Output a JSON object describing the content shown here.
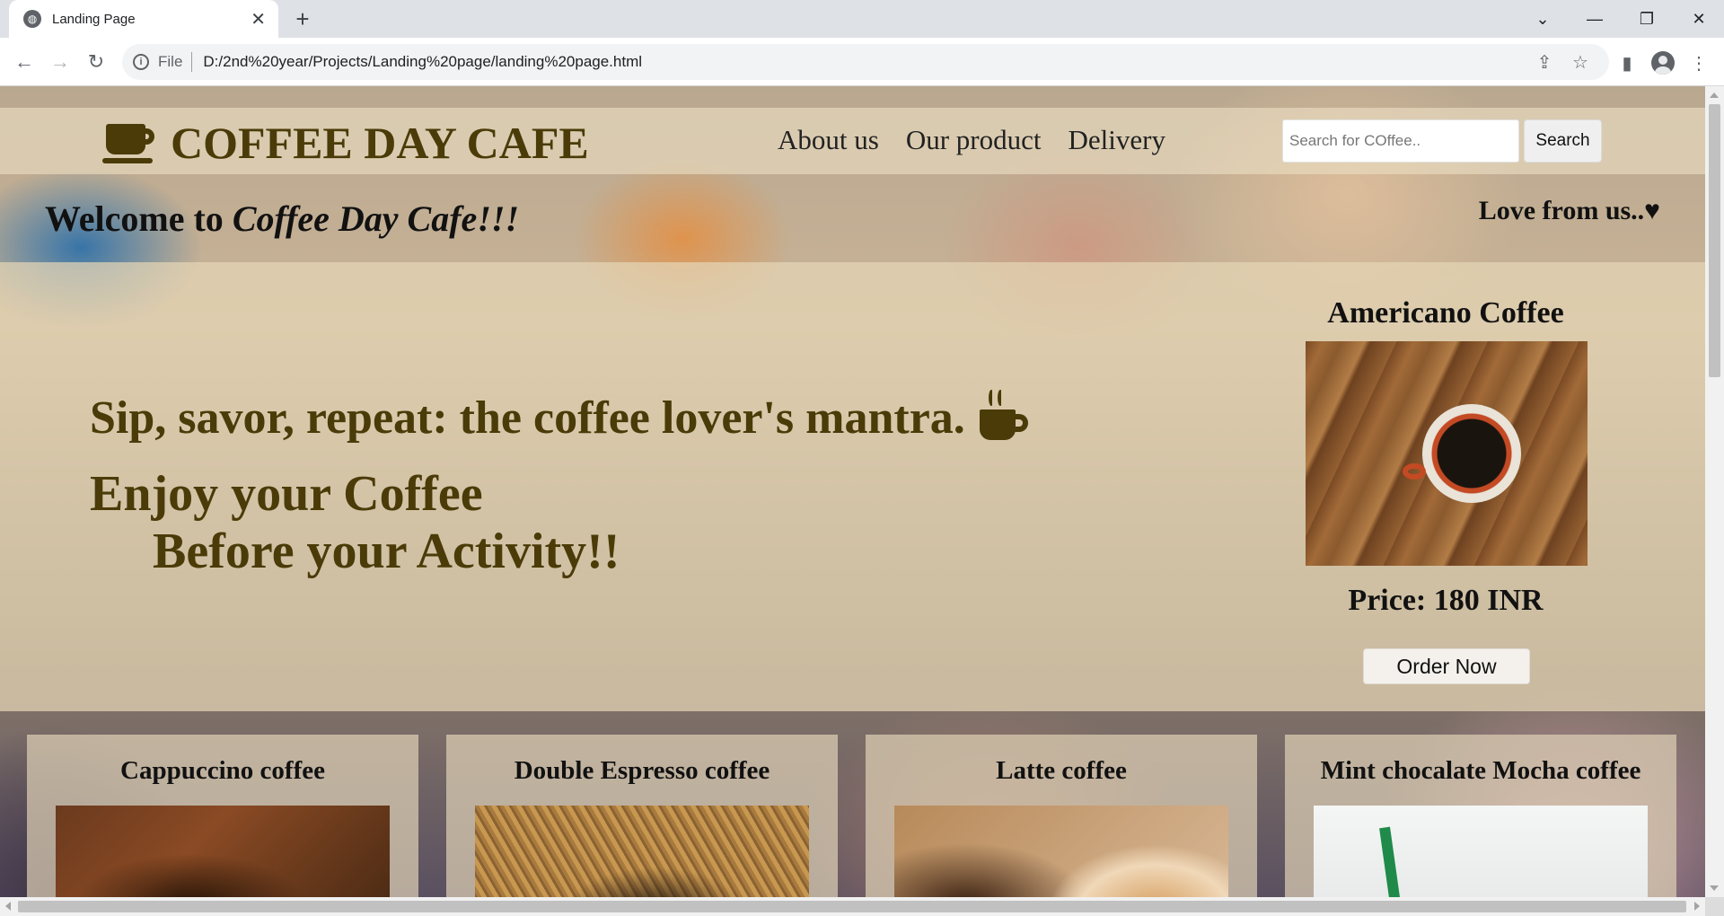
{
  "browser": {
    "tab_title": "Landing Page",
    "new_tab": "+",
    "tab_close": "✕",
    "controls": {
      "tabsearch": "⌄",
      "minimize": "—",
      "restore": "❐",
      "close": "✕"
    },
    "nav": {
      "back": "←",
      "forward": "→",
      "reload": "↻"
    },
    "info_icon": "i",
    "url_scheme": "File",
    "url": "D:/2nd%20year/Projects/Landing%20page/landing%20page.html",
    "omnibox_icons": {
      "share": "⇪",
      "bookmark": "☆"
    },
    "sidebar_icon": "▮",
    "menu_icon": "⋮"
  },
  "site": {
    "brand": "COFFEE DAY CAFE",
    "nav": [
      "About us",
      "Our product",
      "Delivery"
    ],
    "search": {
      "placeholder": "Search for COffee..",
      "button": "Search"
    },
    "welcome_prefix": "Welcome to ",
    "welcome_name": "Coffee Day Cafe!!!",
    "love": "Love from us..♥",
    "tagline": "Sip, savor, repeat: the coffee lover's mantra.",
    "hero_line1": "Enjoy your Coffee",
    "hero_line2": "Before your Activity!!",
    "featured": {
      "title": "Americano Coffee",
      "price": "Price: 180 INR",
      "button": "Order Now"
    },
    "products": [
      {
        "name": "Cappuccino coffee"
      },
      {
        "name": "Double Espresso coffee"
      },
      {
        "name": "Latte coffee"
      },
      {
        "name": "Mint chocalate Mocha coffee"
      }
    ]
  },
  "colors": {
    "brand_brown": "#4a3b08",
    "chrome_bg": "#dee1e6"
  }
}
